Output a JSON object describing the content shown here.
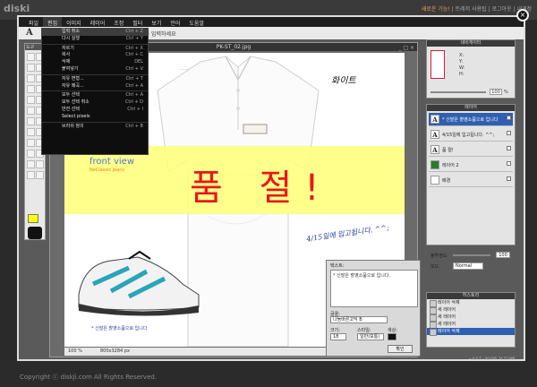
{
  "site": {
    "logo": "diski",
    "links": [
      "새로운 기능!",
      "트레저 사용팁",
      "로그아웃",
      "내게정"
    ],
    "copyright": "Copyright ⓒ diskji.com All Rights Reserved."
  },
  "app": {
    "menu": [
      "파일",
      "편집",
      "이미지",
      "레이어",
      "조정",
      "필터",
      "보기",
      "언어",
      "도움말"
    ],
    "active_menu": 1,
    "options_text": "텍스트를 입력하세요",
    "close_glyph": "×"
  },
  "edit_menu": {
    "items": [
      {
        "label": "입력 취소",
        "shortcut": "Ctrl + Z",
        "highlight": true
      },
      {
        "label": "다시 실행",
        "shortcut": "Ctrl + Y",
        "highlight": false
      },
      {
        "label": "자르기",
        "shortcut": "Ctrl + X",
        "highlight": false
      },
      {
        "label": "복사",
        "shortcut": "Ctrl + C",
        "highlight": false
      },
      {
        "label": "삭제",
        "shortcut": "DEL",
        "highlight": false
      },
      {
        "label": "붙여넣기",
        "shortcut": "Ctrl + V",
        "highlight": false
      },
      {
        "label": "자유 변형...",
        "shortcut": "Ctrl + T",
        "highlight": false
      },
      {
        "label": "자유 왜곡...",
        "shortcut": "Ctrl + A",
        "highlight": false
      },
      {
        "label": "모두 선택",
        "shortcut": "Ctrl + A",
        "highlight": false
      },
      {
        "label": "모두 선택 취소",
        "shortcut": "Ctrl + D",
        "highlight": false
      },
      {
        "label": "반전 선택",
        "shortcut": "Ctrl + I",
        "highlight": false
      },
      {
        "label": "Select pixels",
        "shortcut": "",
        "highlight": false
      },
      {
        "label": "브러쉬 정의",
        "shortcut": "Ctrl + B",
        "highlight": false
      }
    ]
  },
  "toolbox": {
    "title": "도구",
    "fg_color": "#ffff00",
    "bg_color": "#111111"
  },
  "document": {
    "title": "PK-ST_02.jpg",
    "buttons": "_ □ ×",
    "canvas": {
      "soldout_text": "품  절!",
      "white_label": "화이트",
      "front_view": "front view",
      "brand_text": "NeClassic jeans",
      "eta_text": "4/15일에 입고됩니다. ^^;",
      "shoe_note": "* 신발은 촬영소품으로 입니다"
    },
    "zoom": "100 %",
    "size": "800x3284 px"
  },
  "navigator": {
    "title": "네비게이터",
    "x_label": "X:",
    "y_label": "Y:",
    "w_label": "W:",
    "h_label": "H:",
    "zoom": "100",
    "zoom_unit": "%"
  },
  "layers": {
    "title": "레이어",
    "rows": [
      {
        "icon": "A",
        "name": "* 신발은 촬영소품으로 입니다",
        "selected": true
      },
      {
        "icon": "A",
        "name": "4/15일에 입고됩니다. ^^;",
        "selected": false
      },
      {
        "icon": "A",
        "name": "품 절!",
        "selected": false
      },
      {
        "icon": "",
        "name": "레이어 2",
        "selected": false
      },
      {
        "icon": "",
        "name": "배경",
        "selected": false
      }
    ],
    "opacity_label": "불투명도:",
    "opacity_value": "100",
    "mode_label": "모드:",
    "mode_value": "Normal"
  },
  "history": {
    "title": "히스토리",
    "items": [
      {
        "label": "레이어 삭제",
        "selected": false
      },
      {
        "label": "새 레이어",
        "selected": false
      },
      {
        "label": "새 레이어",
        "selected": false
      },
      {
        "label": "새 레이어",
        "selected": false
      },
      {
        "label": "레이어 삭제",
        "selected": true
      }
    ],
    "fps": "• 0.0 T - 00 FPS 74.52 MB"
  },
  "text_dialog": {
    "title": "텍스트:",
    "text": "* 신발은 촬영소품으로 입니다.",
    "font_label": "글꼴:",
    "font_value": "나눔바른고딕 B",
    "size_label": "크기:",
    "size_value": "18",
    "style_label": "스타일:",
    "style_value": "일반(보통)",
    "color_label": "색상:",
    "ok_label": "확인"
  },
  "colors": {
    "accent": "#2f5fb0",
    "soldout": "#e81818",
    "band": "#ffff78"
  }
}
